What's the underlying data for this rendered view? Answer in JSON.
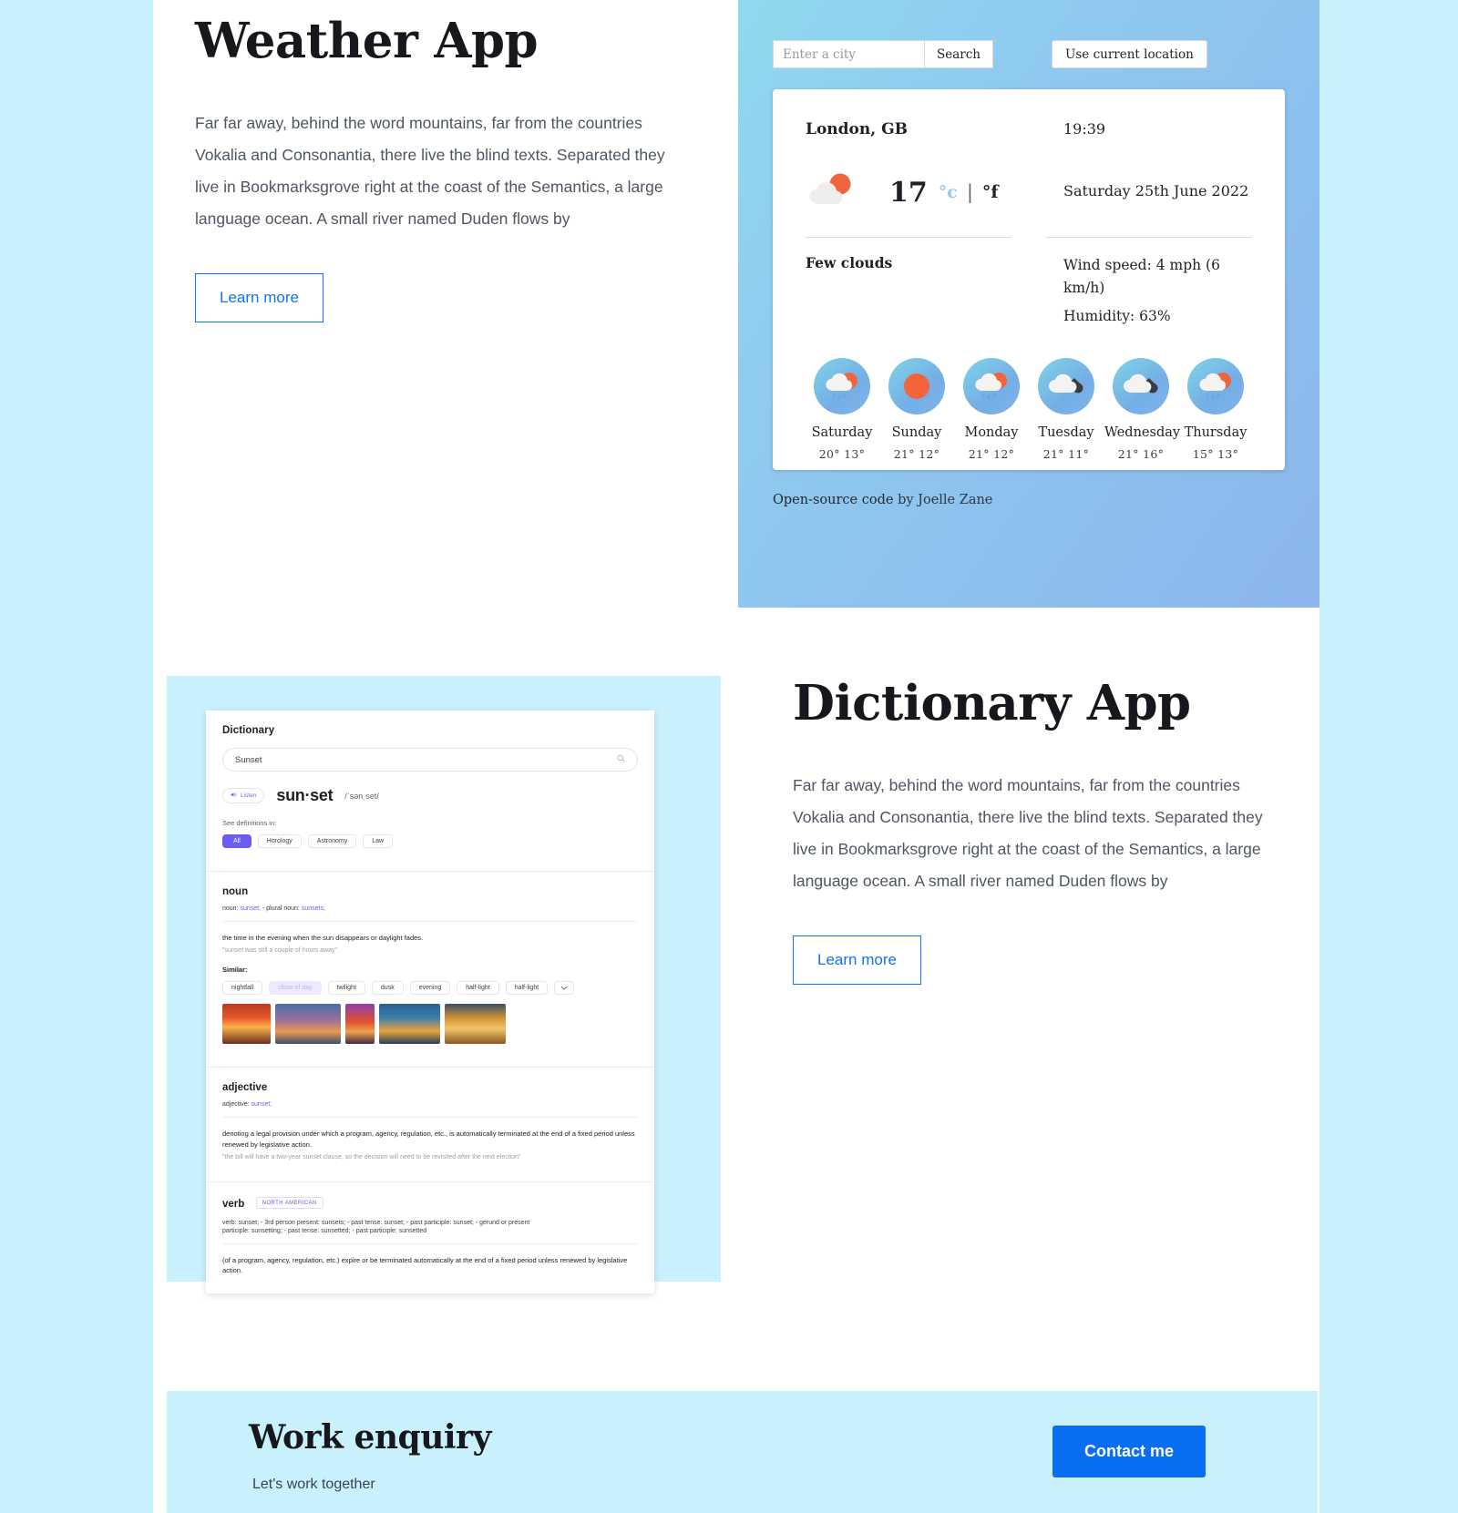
{
  "theme": {
    "page_bg": "#c9f0fd",
    "sheet_bg": "#ffffff",
    "accent_blue": "#0a6ef2",
    "link_blue": "#1272f0",
    "weather_panel_from": "#8fd9ef",
    "weather_panel_to": "#8bb6ec",
    "dict_purple": "#6b5cf6",
    "sun_orange": "#f2643c"
  },
  "weather_section": {
    "title": "Weather App",
    "paragraph": "Far far away, behind the word mountains, far from the countries Vokalia and Consonantia, there live the blind texts. Separated they live in Bookmarksgrove right at the coast of the Semantics, a large language ocean. A small river named Duden flows by",
    "learn_more_label": "Learn more",
    "widget": {
      "search_placeholder": "Enter a city",
      "search_value": "",
      "search_button_label": "Search",
      "location_button_label": "Use current location",
      "city": "London, GB",
      "time": "19:39",
      "temperature": "17",
      "unit_celsius": "°c",
      "unit_separator": "|",
      "unit_fahrenheit": "°f",
      "date": "Saturday 25th June 2022",
      "condition": "Few clouds",
      "wind": "Wind speed: 4 mph (6 km/h)",
      "humidity": "Humidity: 63%",
      "current_icon": "sun-behind-cloud-icon",
      "forecast": [
        {
          "day": "Saturday",
          "high": "20°",
          "low": "13°",
          "icon": "sun-cloud-rain-icon"
        },
        {
          "day": "Sunday",
          "high": "21°",
          "low": "12°",
          "icon": "sun-icon"
        },
        {
          "day": "Monday",
          "high": "21°",
          "low": "12°",
          "icon": "sun-cloud-rain-icon"
        },
        {
          "day": "Tuesday",
          "high": "21°",
          "low": "11°",
          "icon": "cloud-dark-icon"
        },
        {
          "day": "Wednesday",
          "high": "21°",
          "low": "16°",
          "icon": "cloud-dark-icon"
        },
        {
          "day": "Thursday",
          "high": "15°",
          "low": "13°",
          "icon": "sun-cloud-rain-icon"
        }
      ],
      "credit_prefix": "Open-source code",
      "credit_suffix": "by Joelle Zane"
    }
  },
  "dictionary_section": {
    "title": "Dictionary App",
    "paragraph": "Far far away, behind the word mountains, far from the countries Vokalia and Consonantia, there live the blind texts. Separated they live in Bookmarksgrove right at the coast of the Semantics, a large language ocean. A small river named Duden flows by",
    "learn_more_label": "Learn more",
    "screenshot": {
      "app_title": "Dictionary",
      "search_value": "Sunset",
      "search_icon": "search-icon",
      "listen_label": "Listen",
      "listen_icon": "speaker-icon",
      "headword": "sun·set",
      "phonetic": "/ˈsənˌset/",
      "see_definitions_label": "See definitions in:",
      "category_chips": [
        "All",
        "Horology",
        "Astronomy",
        "Law"
      ],
      "active_chip": "All",
      "noun": {
        "pos": "noun",
        "forms_prefix": "noun:",
        "forms_word": "sunset;",
        "forms_mid": "-   plural noun:",
        "forms_plural": "sunsets;",
        "definition": "the time in the evening when the sun disappears or daylight fades.",
        "example": "\"sunset was still a couple of hours away\"",
        "similar_label": "Similar:",
        "similar": [
          "nightfall",
          "close of day",
          "twilight",
          "dusk",
          "evening",
          "half-light",
          "half-light"
        ],
        "similar_ghost": "close of day",
        "more_icon": "chevron-down-icon"
      },
      "adjective": {
        "pos": "adjective",
        "forms_prefix": "adjective:",
        "forms_word": "sunset;",
        "definition": "denoting a legal provision under which a program, agency, regulation, etc., is automatically terminated at the end of a fixed period unless renewed by legislative action.",
        "example": "\"the bill will have a two-year sunset clause, so the decision will need to be revisited after the next election\""
      },
      "verb": {
        "pos": "verb",
        "badge": "NORTH AMERICAN",
        "forms_line1": "verb: sunset;  -  3rd person present: sunsets;  -  past tense: sunset;  -  past participle: sunset;  -  gerund or present",
        "forms_line2": "participle: sunsetting;  -  past tense: sunsetted;  -  past participle: sunsetted",
        "definition": "(of a program, agency, regulation, etc.) expire or be terminated automatically at the end of a fixed period unless renewed by legislative action."
      }
    }
  },
  "enquiry_section": {
    "title": "Work enquiry",
    "subtitle": "Let's work together",
    "contact_button_label": "Contact me"
  }
}
